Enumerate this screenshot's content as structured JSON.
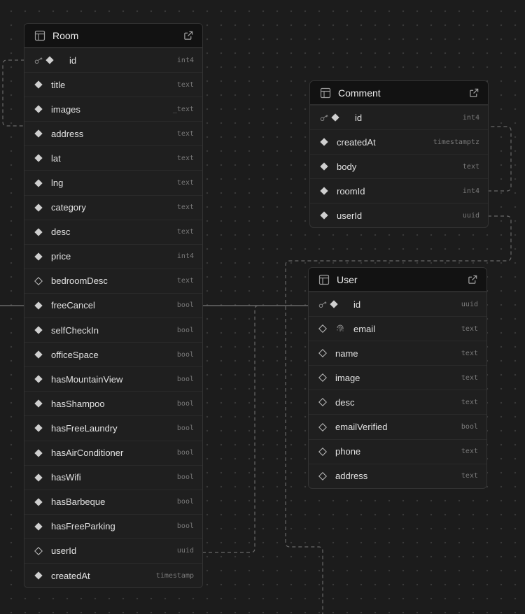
{
  "tables": [
    {
      "name": "Room",
      "columns": [
        {
          "name": "id",
          "type": "int4",
          "primary": true,
          "nullable": false
        },
        {
          "name": "title",
          "type": "text",
          "nullable": false
        },
        {
          "name": "images",
          "type": "_text",
          "nullable": false
        },
        {
          "name": "address",
          "type": "text",
          "nullable": false
        },
        {
          "name": "lat",
          "type": "text",
          "nullable": false
        },
        {
          "name": "lng",
          "type": "text",
          "nullable": false
        },
        {
          "name": "category",
          "type": "text",
          "nullable": false
        },
        {
          "name": "desc",
          "type": "text",
          "nullable": false
        },
        {
          "name": "price",
          "type": "int4",
          "nullable": false
        },
        {
          "name": "bedroomDesc",
          "type": "text",
          "nullable": true
        },
        {
          "name": "freeCancel",
          "type": "bool",
          "nullable": false
        },
        {
          "name": "selfCheckIn",
          "type": "bool",
          "nullable": false
        },
        {
          "name": "officeSpace",
          "type": "bool",
          "nullable": false
        },
        {
          "name": "hasMountainView",
          "type": "bool",
          "nullable": false
        },
        {
          "name": "hasShampoo",
          "type": "bool",
          "nullable": false
        },
        {
          "name": "hasFreeLaundry",
          "type": "bool",
          "nullable": false
        },
        {
          "name": "hasAirConditioner",
          "type": "bool",
          "nullable": false
        },
        {
          "name": "hasWifi",
          "type": "bool",
          "nullable": false
        },
        {
          "name": "hasBarbeque",
          "type": "bool",
          "nullable": false
        },
        {
          "name": "hasFreeParking",
          "type": "bool",
          "nullable": false
        },
        {
          "name": "userId",
          "type": "uuid",
          "nullable": true
        },
        {
          "name": "createdAt",
          "type": "timestamp",
          "nullable": false
        }
      ]
    },
    {
      "name": "Comment",
      "columns": [
        {
          "name": "id",
          "type": "int4",
          "primary": true,
          "nullable": false
        },
        {
          "name": "createdAt",
          "type": "timestamptz",
          "nullable": false
        },
        {
          "name": "body",
          "type": "text",
          "nullable": false
        },
        {
          "name": "roomId",
          "type": "int4",
          "nullable": false
        },
        {
          "name": "userId",
          "type": "uuid",
          "nullable": false
        }
      ]
    },
    {
      "name": "User",
      "columns": [
        {
          "name": "id",
          "type": "uuid",
          "primary": true,
          "nullable": false
        },
        {
          "name": "email",
          "type": "text",
          "nullable": true,
          "unique": true
        },
        {
          "name": "name",
          "type": "text",
          "nullable": true
        },
        {
          "name": "image",
          "type": "text",
          "nullable": true
        },
        {
          "name": "desc",
          "type": "text",
          "nullable": true
        },
        {
          "name": "emailVerified",
          "type": "bool",
          "nullable": true
        },
        {
          "name": "phone",
          "type": "text",
          "nullable": true
        },
        {
          "name": "address",
          "type": "text",
          "nullable": true
        }
      ]
    }
  ],
  "colors": {
    "background": "#1c1c1c",
    "header": "#121212",
    "edge": "#6a6a6a"
  }
}
